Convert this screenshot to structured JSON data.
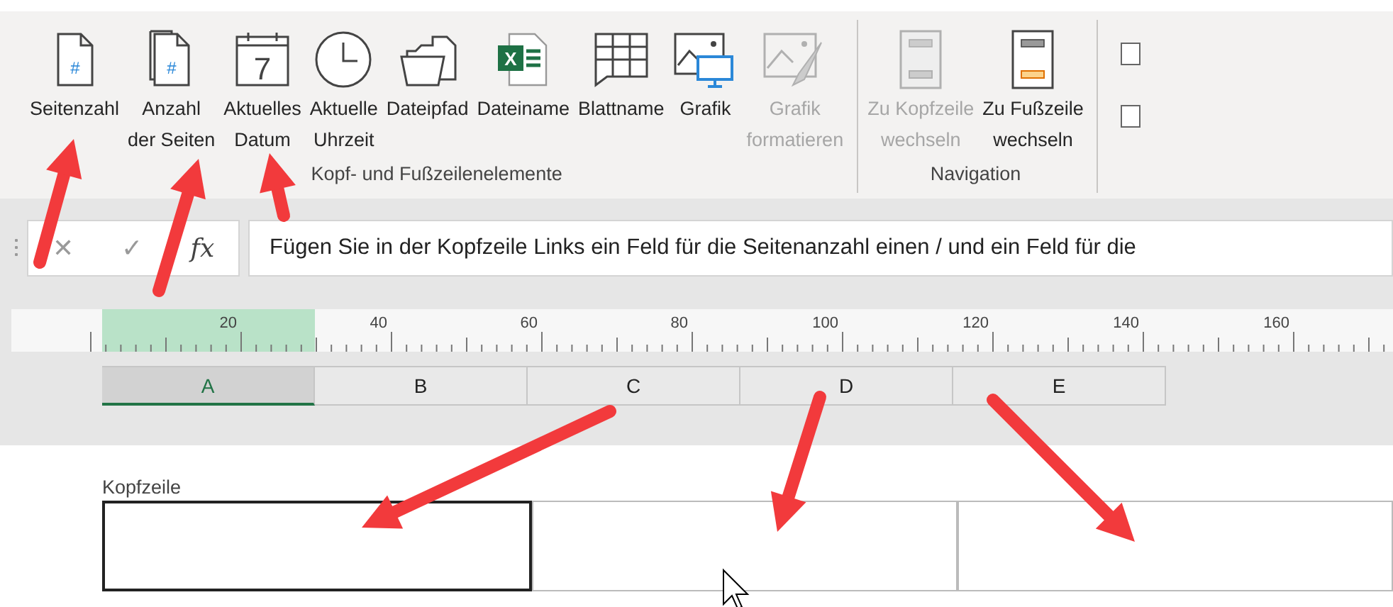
{
  "ribbon": {
    "groups": [
      {
        "label": "Kopf- und Fußzeilenelemente",
        "buttons": [
          {
            "kind": "page-number",
            "icon_text": "#",
            "lines": [
              "Seitenzahl"
            ],
            "disabled": false
          },
          {
            "kind": "page-count",
            "icon_text": "#",
            "lines": [
              "Anzahl",
              "der Seiten"
            ],
            "disabled": false
          },
          {
            "kind": "date",
            "icon_text": "7",
            "lines": [
              "Aktuelles",
              "Datum"
            ],
            "disabled": false
          },
          {
            "kind": "time",
            "lines": [
              "Aktuelle",
              "Uhrzeit"
            ],
            "disabled": false
          },
          {
            "kind": "path",
            "lines": [
              "Dateipfad"
            ],
            "disabled": false
          },
          {
            "kind": "excel",
            "icon_text": "X",
            "lines": [
              "Dateiname"
            ],
            "disabled": false
          },
          {
            "kind": "sheet",
            "lines": [
              "Blattname"
            ],
            "disabled": false
          },
          {
            "kind": "picture",
            "lines": [
              "Grafik"
            ],
            "disabled": false
          },
          {
            "kind": "format-picture",
            "lines": [
              "Grafik",
              "formatieren"
            ],
            "disabled": true
          }
        ]
      },
      {
        "label": "Navigation",
        "buttons": [
          {
            "kind": "to-header",
            "lines": [
              "Zu Kopfzeile",
              "wechseln"
            ],
            "disabled": true
          },
          {
            "kind": "to-footer",
            "lines": [
              "Zu Fußzeile",
              "wechseln"
            ],
            "disabled": false
          }
        ]
      }
    ],
    "options": [
      {
        "checked": false
      },
      {
        "checked": false
      }
    ]
  },
  "formula_bar": {
    "cancel": "✕",
    "enter": "✓",
    "function": "fx",
    "value": "Fügen Sie in der Kopfzeile Links ein Feld für die Seitenanzahl einen / und ein Feld für die"
  },
  "ruler": {
    "labels": [
      "20",
      "40",
      "60",
      "80",
      "100",
      "120",
      "140",
      "160"
    ]
  },
  "columns": [
    {
      "label": "A",
      "selected": true
    },
    {
      "label": "B",
      "selected": false
    },
    {
      "label": "C",
      "selected": false
    },
    {
      "label": "D",
      "selected": false
    },
    {
      "label": "E",
      "selected": false
    }
  ],
  "header": {
    "label": "Kopfzeile",
    "sections": [
      {
        "selected": true
      },
      {
        "selected": false
      },
      {
        "selected": false
      }
    ]
  }
}
